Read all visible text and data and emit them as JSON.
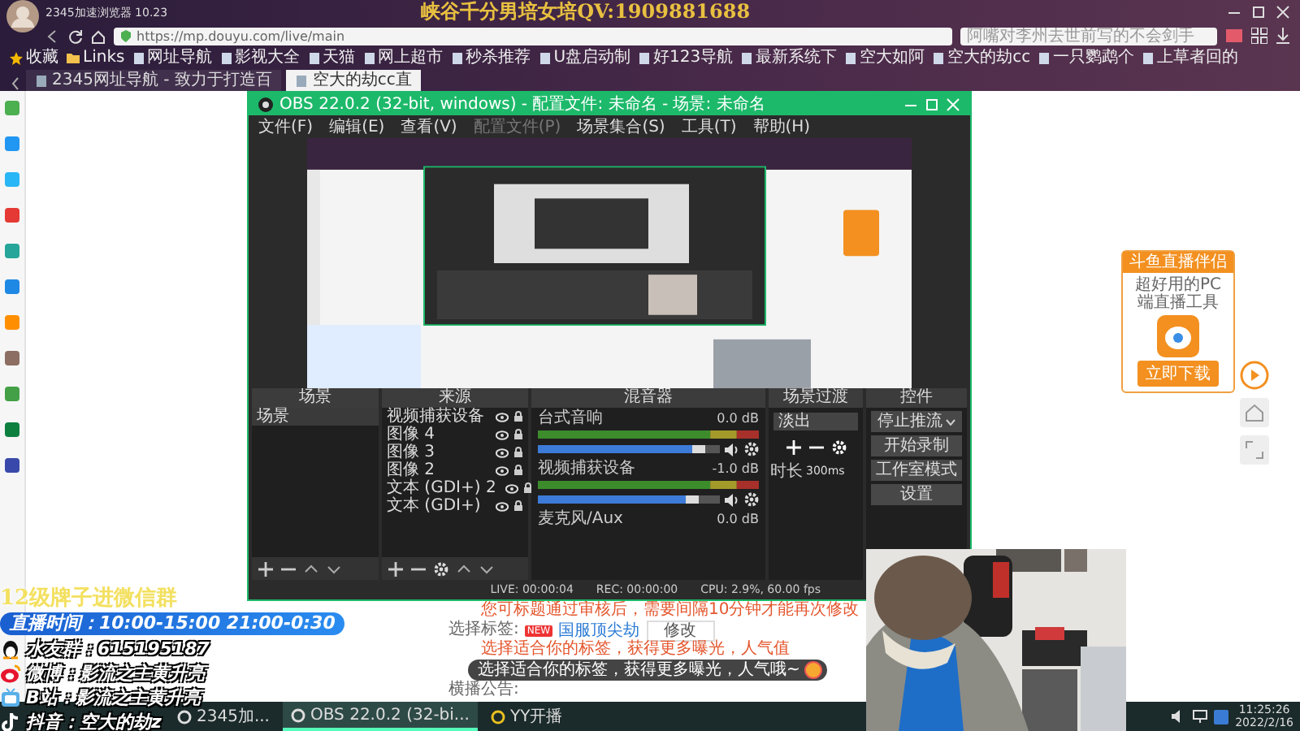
{
  "browser": {
    "title": "2345加速浏览器 10.23",
    "address": "https://mp.douyu.com/live/main",
    "search_placeholder": "阿嘴对李州去世前写的不会剑手",
    "bookmarks": [
      "收藏",
      "Links",
      "网址导航",
      "影视大全",
      "天猫",
      "网上超市",
      "秒杀推荐",
      "U盘启动制",
      "好123导航",
      "最新系统下",
      "空大如阿",
      "空大的劫cc",
      "一只鹦鹉个",
      "上草者回的"
    ],
    "tabs": [
      {
        "label": "2345网址导航 - 致力于打造百",
        "selected": false
      },
      {
        "label": "空大的劫cc直",
        "selected": true
      }
    ],
    "page": {
      "notice": "您可标题通过审核后，需要间隔10分钟才能再次修改",
      "new_badge": "NEW",
      "tag_label": "选择标签:",
      "tag_value": "国服顶尖劫",
      "edit_button": "修改",
      "tag_hint": "选择适合你的标签，获得更多曝光，人气值",
      "bubble": "选择适合你的标签，获得更多曝光，人气哦~",
      "announcement_label": "横播公告:"
    },
    "promo_card": {
      "title": "斗鱼直播伴侣",
      "subtitle": "超好用的PC端直播工具",
      "button": "立即下载"
    }
  },
  "obs": {
    "title": "OBS 22.0.2 (32-bit, windows) - 配置文件: 未命名 - 场景: 未命名",
    "menu": [
      {
        "label": "文件(F)",
        "disabled": false
      },
      {
        "label": "编辑(E)",
        "disabled": false
      },
      {
        "label": "查看(V)",
        "disabled": false
      },
      {
        "label": "配置文件(P)",
        "disabled": true
      },
      {
        "label": "场景集合(S)",
        "disabled": false
      },
      {
        "label": "工具(T)",
        "disabled": false
      },
      {
        "label": "帮助(H)",
        "disabled": false
      }
    ],
    "docks": {
      "scenes": {
        "title": "场景",
        "items": [
          {
            "label": "场景",
            "selected": true
          }
        ]
      },
      "sources": {
        "title": "来源",
        "items": [
          "视频捕获设备",
          "图像 4",
          "图像 3",
          "图像 2",
          "文本 (GDI+) 2",
          "文本 (GDI+)"
        ]
      },
      "mixer": {
        "title": "混音器",
        "channels": [
          {
            "name": "台式音响",
            "reading": "0.0 dB",
            "level": 0.92
          },
          {
            "name": "视频捕获设备",
            "reading": "-1.0 dB",
            "level": 0.88
          }
        ],
        "partial_channel": {
          "name": "麦克风/Aux",
          "reading": "0.0 dB"
        }
      },
      "transitions": {
        "title": "场景过渡",
        "transition": "淡出",
        "duration_label": "时长",
        "duration": "300ms"
      },
      "controls": {
        "title": "控件",
        "buttons": [
          "停止推流",
          "开始录制",
          "工作室模式",
          "设置"
        ]
      }
    },
    "status": [
      "LIVE: 00:00:04",
      "REC: 00:00:00",
      "CPU: 2.9%, 60.00 fps"
    ]
  },
  "stream_overlay": {
    "banner": "峡谷千分男培女培QV:1909881688",
    "notice": "12级牌子进微信群",
    "schedule": "直播时间：10:00-15:00 21:00-0:30",
    "socials": [
      {
        "kind": "qq",
        "text": "水友群：615195187"
      },
      {
        "kind": "weibo",
        "text": "微博：影流之主黄升亮"
      },
      {
        "kind": "bilibili",
        "text": "B站：影流之主黄升亮"
      },
      {
        "kind": "douyin",
        "text": "抖音：空大的劫z"
      }
    ]
  },
  "taskbar": {
    "items": [
      {
        "label": "2345加...",
        "selected": false
      },
      {
        "label": "OBS 22.0.2 (32-bi...",
        "selected": true
      },
      {
        "label": "YY开播",
        "selected": false
      }
    ],
    "time": "11:25:26",
    "date": "2022/2/16"
  }
}
